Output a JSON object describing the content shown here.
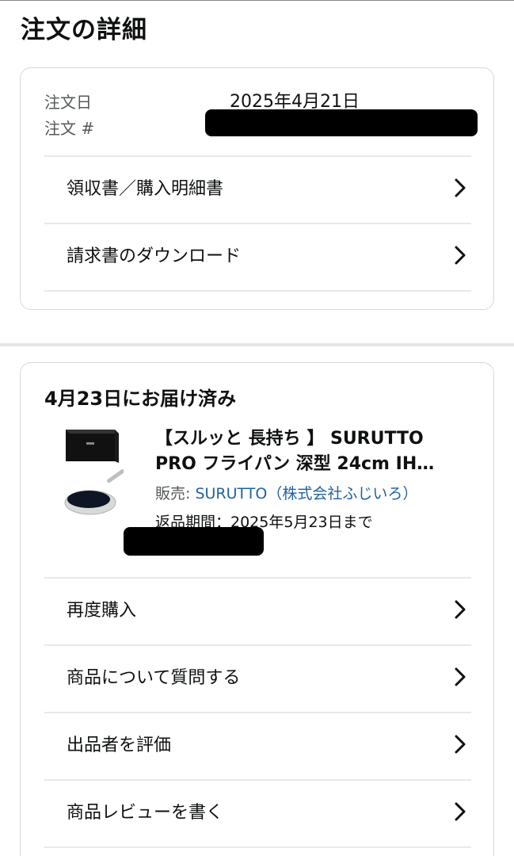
{
  "page": {
    "title": "注文の詳細"
  },
  "order": {
    "date_label": "注文日",
    "date_value": "2025年4月21日",
    "number_label": "注文 #"
  },
  "order_links": [
    {
      "label": "領収書／購入明細書"
    },
    {
      "label": "請求書のダウンロード"
    }
  ],
  "shipment": {
    "status": "4月23日にお届け済み",
    "product": {
      "title_line1": "【スルッと 長持ち 】 SURUTTO",
      "title_line2": "PRO フライパン 深型 24cm IH…",
      "seller_prefix": "販売: ",
      "seller_name": "SURUTTO（株式会社ふじいろ）",
      "returns": "返品期間：2025年5月23日まで"
    },
    "actions": [
      {
        "label": "再度購入"
      },
      {
        "label": "商品について質問する"
      },
      {
        "label": "出品者を評価"
      },
      {
        "label": "商品レビューを書く"
      }
    ]
  },
  "colors": {
    "link": "#2162a1",
    "border": "#d5d9d9",
    "muted": "#565959"
  },
  "icons": {
    "row_chevron": "chevron-right-icon"
  }
}
